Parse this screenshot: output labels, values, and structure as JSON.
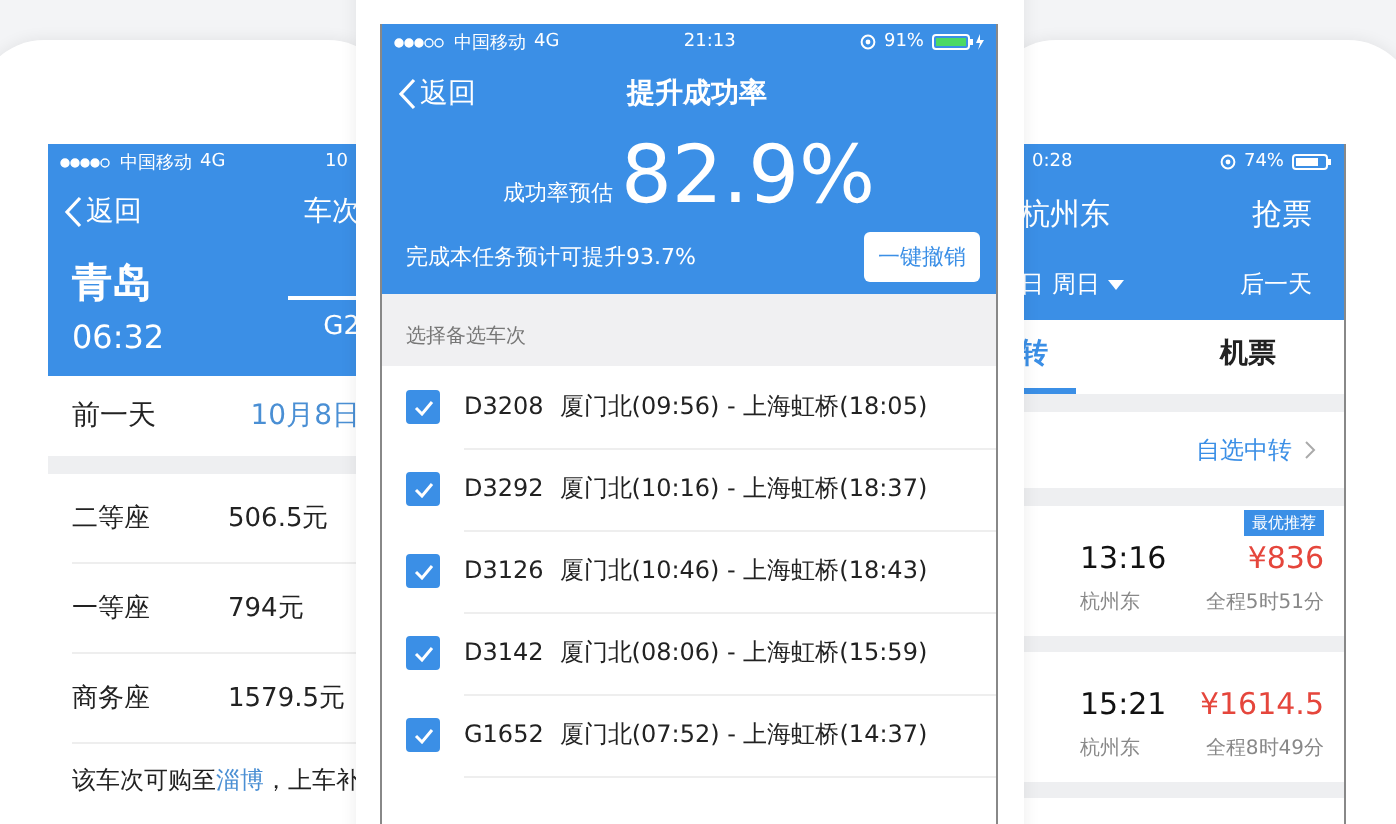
{
  "left_phone": {
    "status_bar": {
      "carrier": "中国移动",
      "network": "4G",
      "time": "10"
    },
    "nav": {
      "back": "返回",
      "title": "车次"
    },
    "departure": {
      "station": "青岛",
      "time": "06:32"
    },
    "train_code": "G2",
    "date_bar": {
      "prev": "前一天",
      "date": "10月8日"
    },
    "seats": [
      {
        "name": "二等座",
        "price": "506.5元"
      },
      {
        "name": "一等座",
        "price": "794元"
      },
      {
        "name": "商务座",
        "price": "1579.5元"
      }
    ],
    "note": {
      "before": "该车次可购至",
      "link": "淄博",
      "after": "，上车补"
    }
  },
  "center_phone": {
    "status_bar": {
      "carrier": "中国移动",
      "network": "4G",
      "time": "21:13",
      "battery": "91%"
    },
    "nav": {
      "back": "返回",
      "title": "提升成功率"
    },
    "estimate": {
      "label": "成功率预估",
      "value": "82.9%"
    },
    "boost_text": "完成本任务预计可提升93.7%",
    "undo_button": "一键撤销",
    "section_title": "选择备选车次",
    "trains": [
      {
        "code": "D3208",
        "route": "厦门北(09:56) - 上海虹桥(18:05)",
        "checked": true
      },
      {
        "code": "D3292",
        "route": "厦门北(10:16) - 上海虹桥(18:37)",
        "checked": true
      },
      {
        "code": "D3126",
        "route": "厦门北(10:46) - 上海虹桥(18:43)",
        "checked": true
      },
      {
        "code": "D3142",
        "route": "厦门北(08:06) - 上海虹桥(15:59)",
        "checked": true
      },
      {
        "code": "G1652",
        "route": "厦门北(07:52) - 上海虹桥(14:37)",
        "checked": true
      }
    ]
  },
  "right_phone": {
    "status_bar": {
      "time": "0:28",
      "battery": "74%"
    },
    "nav": {
      "title": "杭州东",
      "action": "抢票"
    },
    "date_bar": {
      "date": "日 周日",
      "next": "后一天"
    },
    "tabs": [
      {
        "label": "转",
        "selected": true
      },
      {
        "label": "机票",
        "selected": false
      }
    ],
    "custom_transfer": "自选中转",
    "results": [
      {
        "badge": "最优推荐",
        "time": "13:16",
        "price": "¥836",
        "station": "杭州东",
        "duration": "全程5时51分"
      },
      {
        "time": "15:21",
        "price": "¥1614.5",
        "station": "杭州东",
        "duration": "全程8时49分"
      }
    ]
  }
}
